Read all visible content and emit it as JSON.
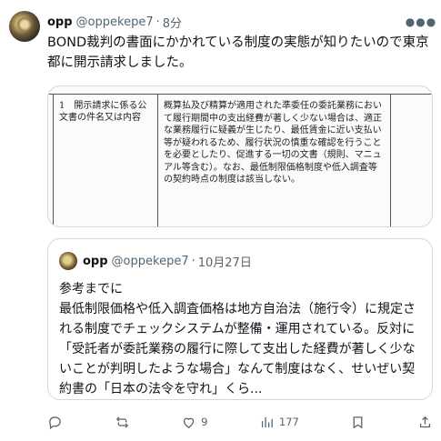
{
  "post": {
    "display_name": "opp",
    "handle": "@oppekepe7",
    "separator": "·",
    "time": "8分",
    "text": "BOND裁判の書面にかかれている制度の実態が知りたいので東京都に開示請求しました。",
    "more_icon": "more-horizontal-icon"
  },
  "document": {
    "left_cell": "1　開示請求に係る公文書の件名又は内容",
    "right_cell": "概算払及び精算が適用された準委任の委託業務において履行期間中の支出経費が著しく少ない場合は、適正な業務履行に疑義が生じたり、最低賃金に近い支払い等が疑われるため、履行状況の慎重な確認を行うことを必要としたり、促進する一切の文書（規則、マニュアル等含む）。なお、最低制限価格制度や低入調査等の契約時点の制度は該当しない。"
  },
  "quote": {
    "display_name": "opp",
    "handle": "@oppekepe7",
    "separator": "·",
    "date": "10月27日",
    "text": "参考までに\n最低制限価格や低入調査価格は地方自治法（施行令）に規定される制度でチェックシステムが整備・運用されている。反対に「受託者が委託業務の履行に際して支出した経費が著しく少ないことが判明したような場合」なんて制度はなく、せいぜい契約書の「日本の法令を守れ」くら..."
  },
  "actions": {
    "reply_icon": "reply-icon",
    "repost_icon": "repost-icon",
    "like_icon": "heart-icon",
    "like_count": "9",
    "views_icon": "analytics-icon",
    "views_count": "177",
    "bookmark_icon": "bookmark-icon",
    "share_icon": "share-icon"
  }
}
